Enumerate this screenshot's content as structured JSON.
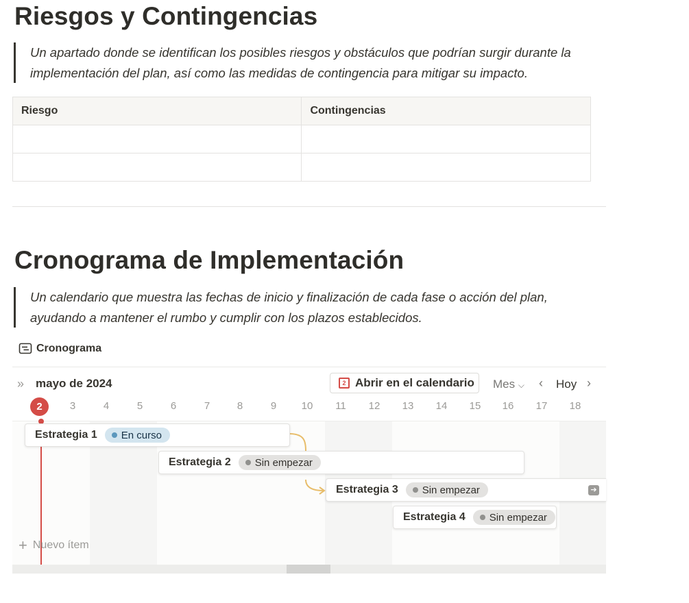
{
  "risks": {
    "title": "Riesgos y Contingencias",
    "quote_line1": "Un apartado donde se identifican los posibles riesgos y obstáculos que podrían surgir durante la",
    "quote_line2": "implementación del plan, así como las medidas de contingencia para mitigar su impacto.",
    "table": {
      "headers": [
        "Riesgo",
        "Contingencias"
      ],
      "rows": [
        [
          "",
          ""
        ],
        [
          "",
          ""
        ]
      ]
    }
  },
  "schedule": {
    "title": "Cronograma de Implementación",
    "quote_line1": "Un calendario que muestra las fechas de inicio y finalización de cada fase o acción del plan,",
    "quote_line2": "ayudando a mantener el rumbo y cumplir con los plazos establecidos.",
    "view_tab_label": "Cronograma",
    "view_tab_icon": "timeline-view-icon",
    "toolbar": {
      "month": "mayo de 2024",
      "open_calendar_label": "Abrir en el calendario",
      "calendar_icon_day": "2",
      "mes_label": "Mes",
      "hoy_label": "Hoy"
    },
    "today": "2",
    "days": [
      "3",
      "4",
      "5",
      "6",
      "7",
      "8",
      "9",
      "10",
      "11",
      "12",
      "13",
      "14",
      "15",
      "16",
      "17",
      "18"
    ],
    "items": [
      {
        "title": "Estrategia 1",
        "status": "En curso",
        "status_color": "#d3e5ef"
      },
      {
        "title": "Estrategia 2",
        "status": "Sin empezar",
        "status_color": "#e3e2e0"
      },
      {
        "title": "Estrategia 3",
        "status": "Sin empezar",
        "status_color": "#e3e2e0"
      },
      {
        "title": "Estrategia 4",
        "status": "Sin empezar",
        "status_color": "#e3e2e0"
      }
    ],
    "new_item_label": "Nuevo ítem",
    "accent_color": "#d44c47"
  }
}
